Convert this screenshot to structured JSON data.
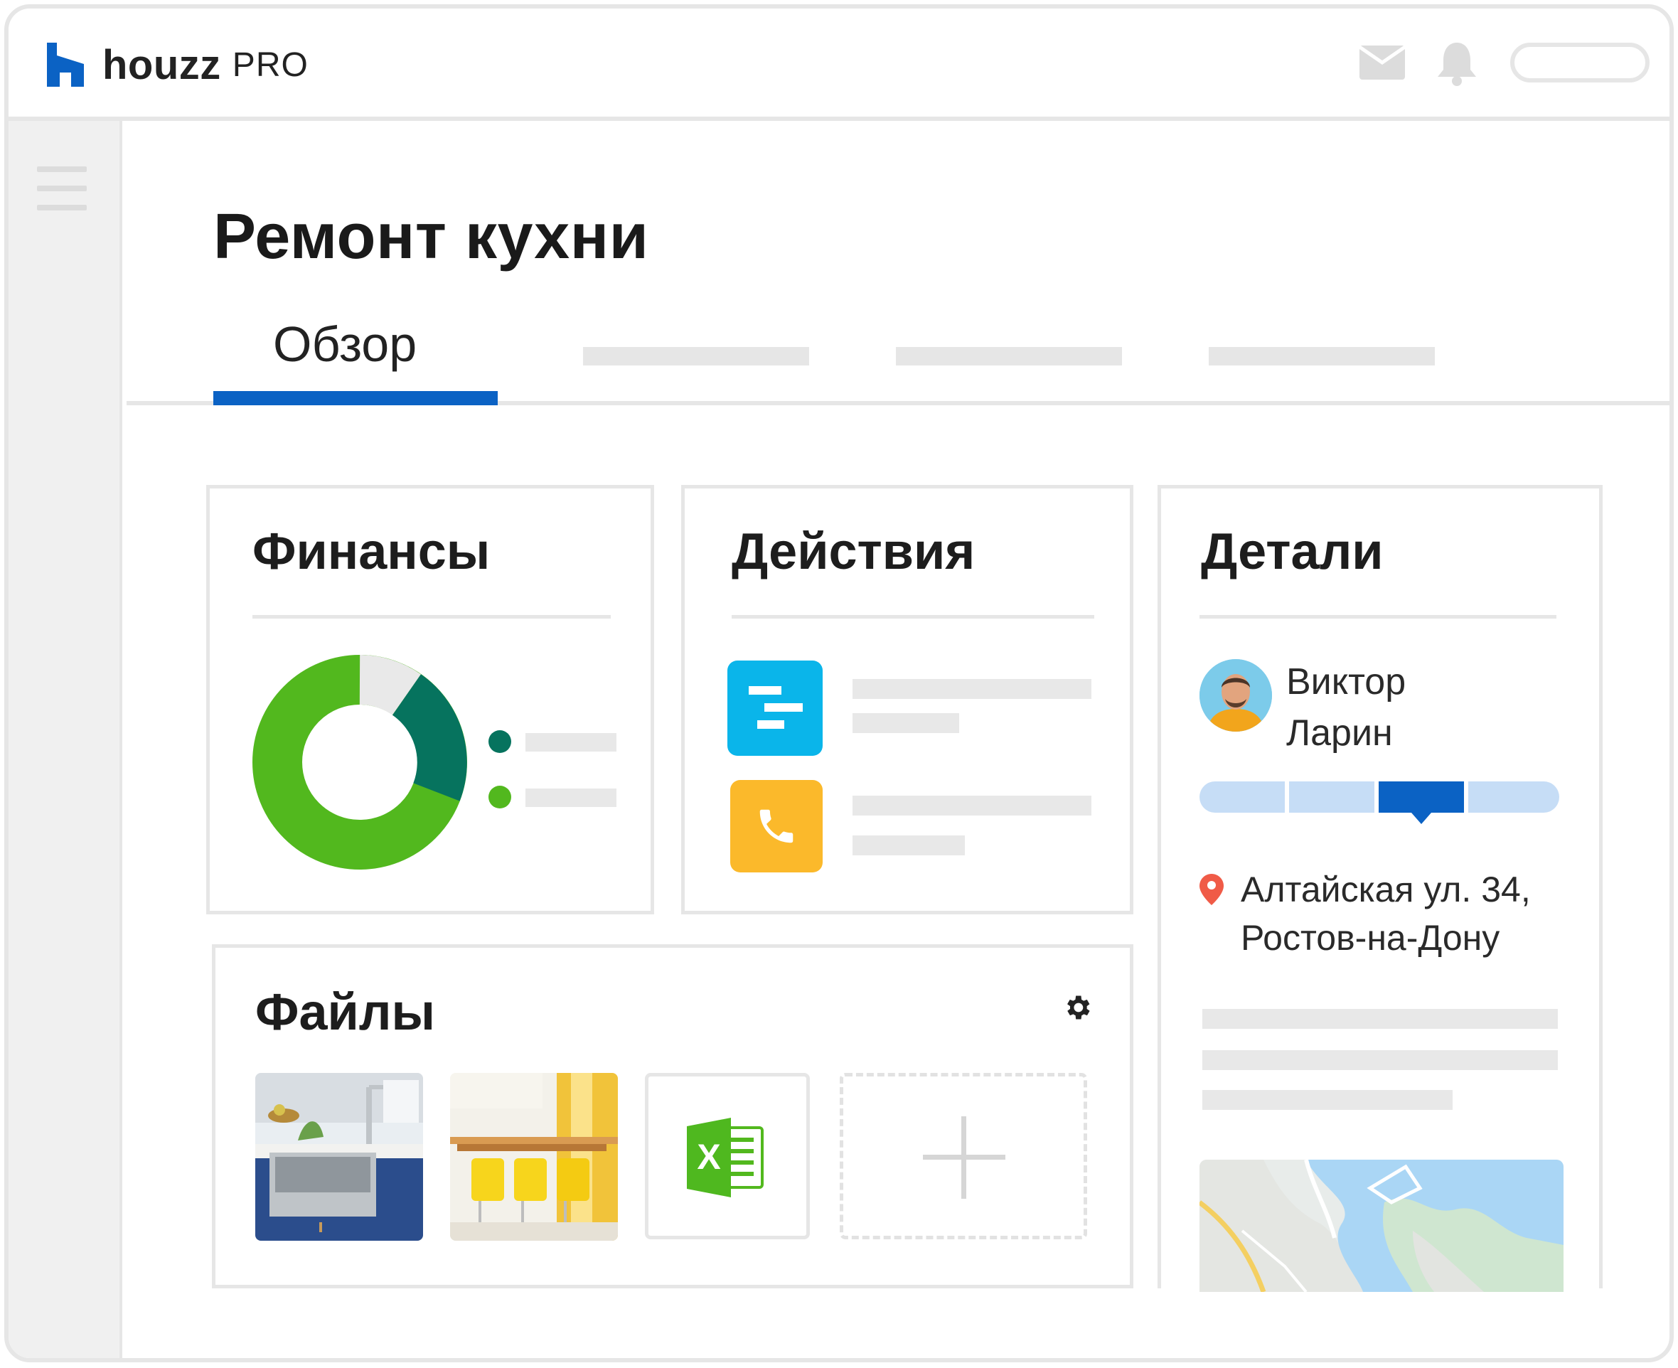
{
  "header": {
    "logo_word": "houzz",
    "logo_suffix": "PRO",
    "brand_color": "#0b62c4"
  },
  "sidebar": {
    "menu_icon": "hamburger-menu-icon"
  },
  "page": {
    "title": "Ремонт кухни",
    "tabs": [
      {
        "label": "Обзор",
        "active": true
      }
    ]
  },
  "finances": {
    "title": "Финансы",
    "donut_icon": "donut-chart-icon",
    "colors": {
      "light_green": "#52b81e",
      "dark_green": "#06735e",
      "grey": "#e9e9e9"
    }
  },
  "actions": {
    "title": "Действия",
    "items": [
      {
        "icon": "timeline-icon",
        "color": "#0ab5ea"
      },
      {
        "icon": "phone-icon",
        "color": "#fbb92b"
      }
    ]
  },
  "files": {
    "title": "Файлы",
    "settings_icon": "gear-icon",
    "items": [
      "kitchen-sink-photo",
      "yellow-chairs-photo",
      "excel-file-icon",
      "add-file-icon"
    ],
    "excel_letter": "X"
  },
  "details": {
    "title": "Детали",
    "person": {
      "first_name": "Виктор",
      "last_name": "Ларин"
    },
    "progress": {
      "steps": 4,
      "current_step": 3,
      "colors": {
        "done": "#c6ddf6",
        "current": "#0b62c4"
      }
    },
    "address": {
      "line1": "Алтайская ул. 34,",
      "line2": "Ростов-на-Дону",
      "icon": "location-pin-icon"
    }
  }
}
